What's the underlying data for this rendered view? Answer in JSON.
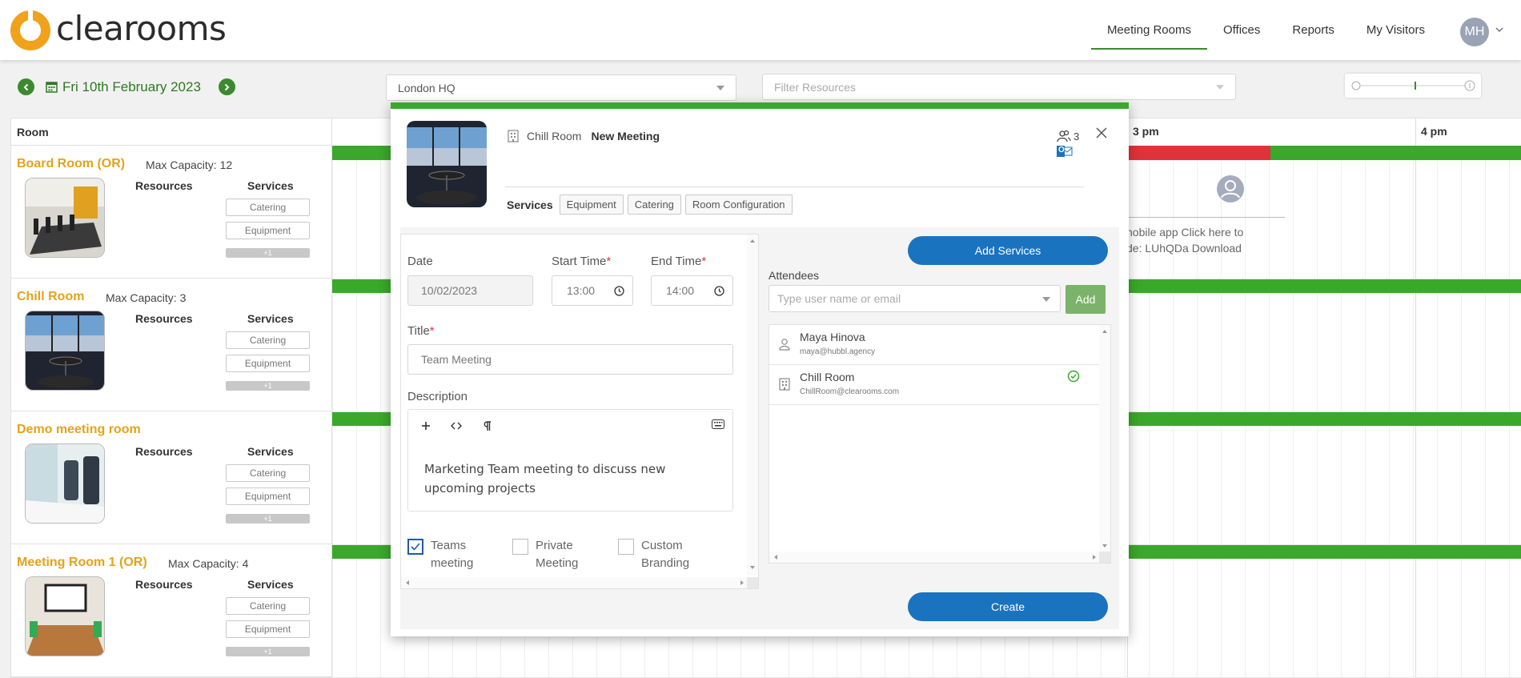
{
  "header": {
    "logo_text": "clearooms",
    "nav": [
      "Meeting Rooms",
      "Offices",
      "Reports",
      "My Visitors"
    ],
    "active_nav": "Meeting Rooms",
    "avatar_initials": "MH"
  },
  "toolbar": {
    "date": "Fri 10th February 2023",
    "location": "London HQ",
    "filter_placeholder": "Filter Resources"
  },
  "rooms_panel": {
    "header": "Room",
    "resources_label": "Resources",
    "services_label": "Services",
    "service_pills": [
      "Catering",
      "Equipment"
    ],
    "more_label": "+1",
    "rooms": [
      {
        "name": "Board Room (OR)",
        "capacity": "Max Capacity: 12"
      },
      {
        "name": "Chill Room",
        "capacity": "Max Capacity: 3"
      },
      {
        "name": "Demo meeting room",
        "capacity": ""
      },
      {
        "name": "Meeting Room 1 (OR)",
        "capacity": "Max Capacity: 4"
      }
    ]
  },
  "timeline": {
    "hours": [
      "3 pm",
      "4 pm"
    ],
    "booking_text_1": "nobile app Click here to",
    "booking_text_2": "de: LUhQDa Download"
  },
  "modal": {
    "room": "Chill Room",
    "title": "New Meeting",
    "people_count": "3",
    "outlook_badge": "O",
    "services_label": "Services",
    "tabs": [
      "Equipment",
      "Catering",
      "Room Configuration"
    ],
    "date_label": "Date",
    "date_value": "10/02/2023",
    "start_label": "Start Time",
    "start_value": "13:00",
    "end_label": "End Time",
    "end_value": "14:00",
    "required_mark": "*",
    "title_label": "Title",
    "title_value": "Team Meeting",
    "description_label": "Description",
    "description_value": "Marketing Team meeting to discuss new upcoming projects",
    "checkboxes": [
      {
        "label1": "Teams",
        "label2": "meeting",
        "checked": true
      },
      {
        "label1": "Private",
        "label2": "Meeting",
        "checked": false
      },
      {
        "label1": "Custom",
        "label2": "Branding",
        "checked": false
      }
    ],
    "add_services": "Add Services",
    "attendees_label": "Attendees",
    "attendee_placeholder": "Type user name or email",
    "add_label": "Add",
    "attendees": [
      {
        "name": "Maya Hinova",
        "email": "maya@hubbl.agency"
      },
      {
        "name": "Chill Room",
        "email": "ChillRoom@clearooms.com"
      }
    ],
    "create_label": "Create"
  },
  "colors": {
    "brand_green": "#3aa82a",
    "accent_orange": "#e5a21b",
    "busy_red": "#e0323a",
    "primary_blue": "#1a73bf"
  }
}
